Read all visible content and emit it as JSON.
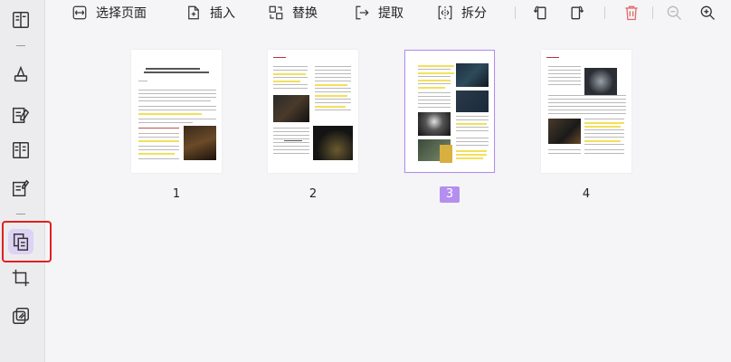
{
  "toolbar": {
    "select_pages": "选择页面",
    "insert": "插入",
    "replace": "替换",
    "extract": "提取",
    "split": "拆分"
  },
  "pages": [
    {
      "number": "1",
      "selected": false
    },
    {
      "number": "2",
      "selected": false
    },
    {
      "number": "3",
      "selected": true
    },
    {
      "number": "4",
      "selected": false
    }
  ],
  "colors": {
    "accent": "#b48ff0",
    "highlight_box": "#e02020",
    "delete_icon": "#e36a6a"
  },
  "icons": [
    "reading-mode-icon",
    "comment-icon",
    "edit-icon",
    "form-icon",
    "sign-icon",
    "organize-pages-icon",
    "crop-icon",
    "convert-icon",
    "select-pages-icon",
    "insert-icon",
    "replace-icon",
    "extract-icon",
    "split-icon",
    "rotate-left-icon",
    "rotate-right-icon",
    "delete-icon",
    "zoom-out-icon",
    "zoom-in-icon"
  ]
}
